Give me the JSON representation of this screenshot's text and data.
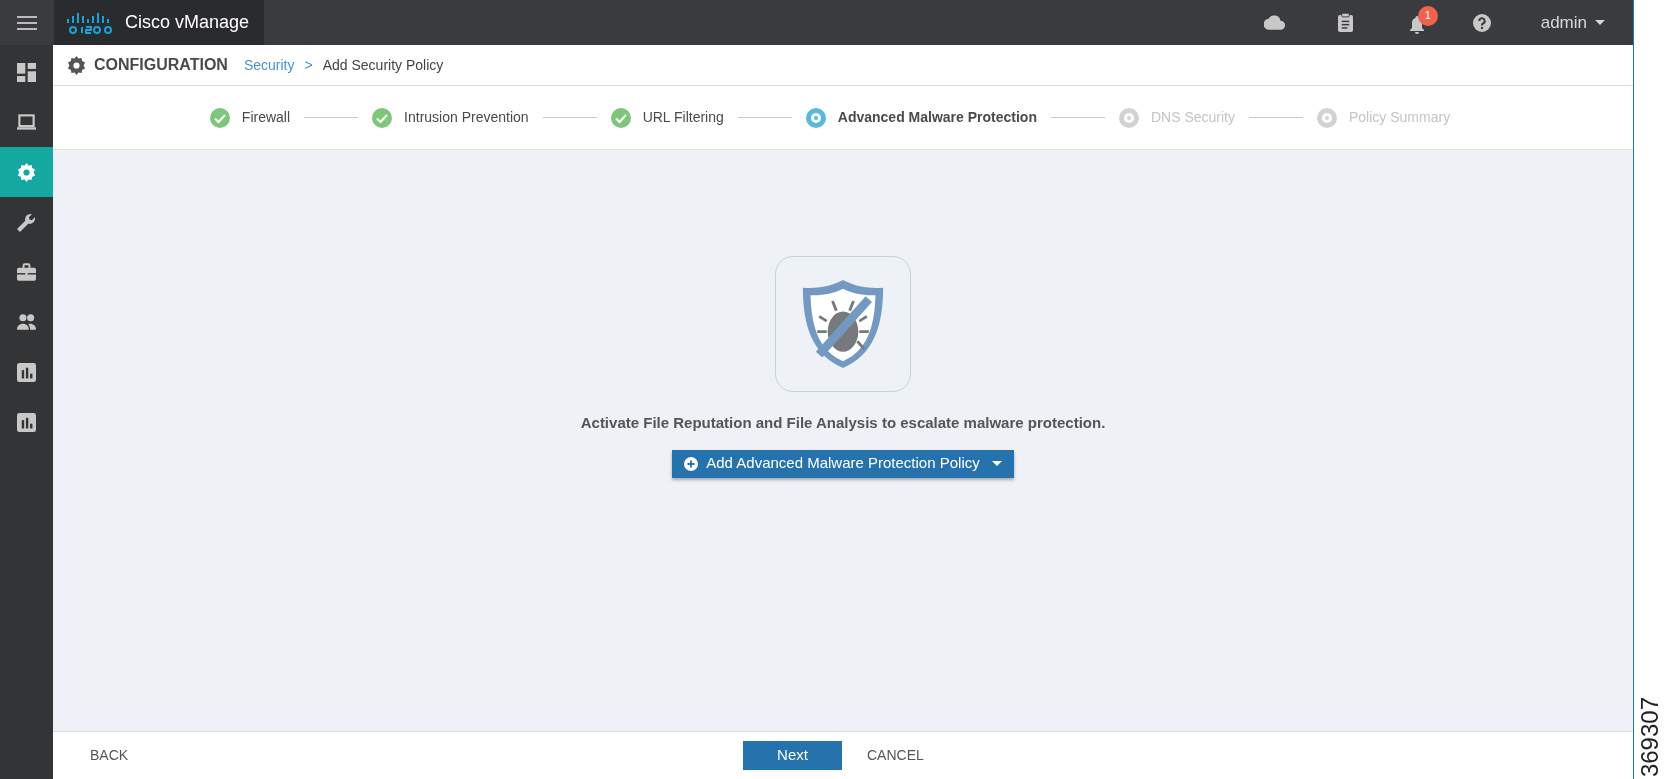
{
  "top_bar": {
    "app_name": "Cisco vManage",
    "notification_count": "1",
    "user": "admin"
  },
  "sidebar": {
    "items": [
      {
        "kind": "dashboard",
        "selected": false
      },
      {
        "kind": "monitor",
        "selected": false
      },
      {
        "kind": "configuration",
        "selected": true
      },
      {
        "kind": "tools",
        "selected": false
      },
      {
        "kind": "maintenance",
        "selected": false
      },
      {
        "kind": "administration",
        "selected": false
      },
      {
        "kind": "analytics",
        "selected": false
      },
      {
        "kind": "reports",
        "selected": false
      }
    ]
  },
  "header": {
    "title": "CONFIGURATION",
    "breadcrumb": [
      {
        "label": "Security",
        "link": true
      },
      {
        "label": "Add Security Policy",
        "link": false
      }
    ],
    "separator": ">"
  },
  "steps": [
    {
      "label": "Firewall",
      "completed": true,
      "selected": false
    },
    {
      "label": "Intrusion Prevention",
      "completed": true,
      "selected": false
    },
    {
      "label": "URL Filtering",
      "completed": true,
      "selected": false
    },
    {
      "label": "Advanced Malware Protection",
      "completed": false,
      "selected": true
    },
    {
      "label": "DNS Security",
      "completed": false,
      "selected": false
    },
    {
      "label": "Policy Summary",
      "completed": false,
      "selected": false
    }
  ],
  "content": {
    "message": "Activate File Reputation and File Analysis to escalate malware protection.",
    "add_button": "Add Advanced Malware Protection Policy"
  },
  "footer": {
    "back": "BACK",
    "next": "Next",
    "cancel": "CANCEL"
  },
  "figure_number": "369307"
}
